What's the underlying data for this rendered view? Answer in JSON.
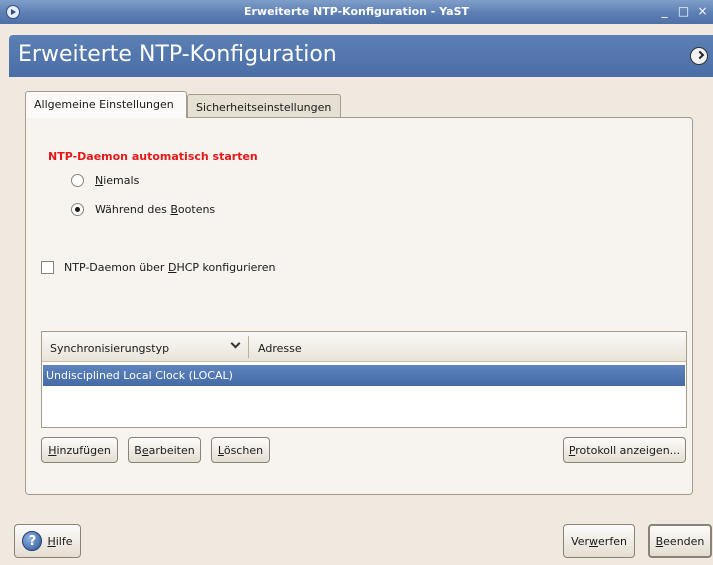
{
  "window": {
    "title": "Erweiterte NTP-Konfiguration - YaST",
    "controls": [
      "_",
      "□",
      "×"
    ]
  },
  "header": {
    "title": "Erweiterte NTP-Konfiguration"
  },
  "tabs": [
    {
      "label": "Allgemeine Einstellungen",
      "active": true
    },
    {
      "label": "Sicherheitseinstellungen",
      "active": false
    }
  ],
  "start_section": {
    "label": "NTP-Daemon automatisch starten",
    "options": [
      {
        "label": "Niemals",
        "checked": false
      },
      {
        "label": "Während des Bootens",
        "checked": true
      }
    ]
  },
  "dhcp_checkbox": {
    "label": "NTP-Daemon über DHCP konfigurieren",
    "checked": false
  },
  "table": {
    "columns": [
      "Synchronisierungstyp",
      "Adresse"
    ],
    "rows": [
      {
        "text": "Undisciplined Local Clock (LOCAL)",
        "selected": true
      }
    ]
  },
  "table_buttons": {
    "add": "Hinzufügen",
    "edit": "Bearbeiten",
    "delete": "Löschen",
    "log": "Protokoll anzeigen..."
  },
  "footer": {
    "help": "Hilfe",
    "discard": "Verwerfen",
    "finish": "Beenden"
  },
  "colors": {
    "accent": "#4a6ea6",
    "section_label": "#e5181a",
    "selection": "#4f76b0"
  }
}
